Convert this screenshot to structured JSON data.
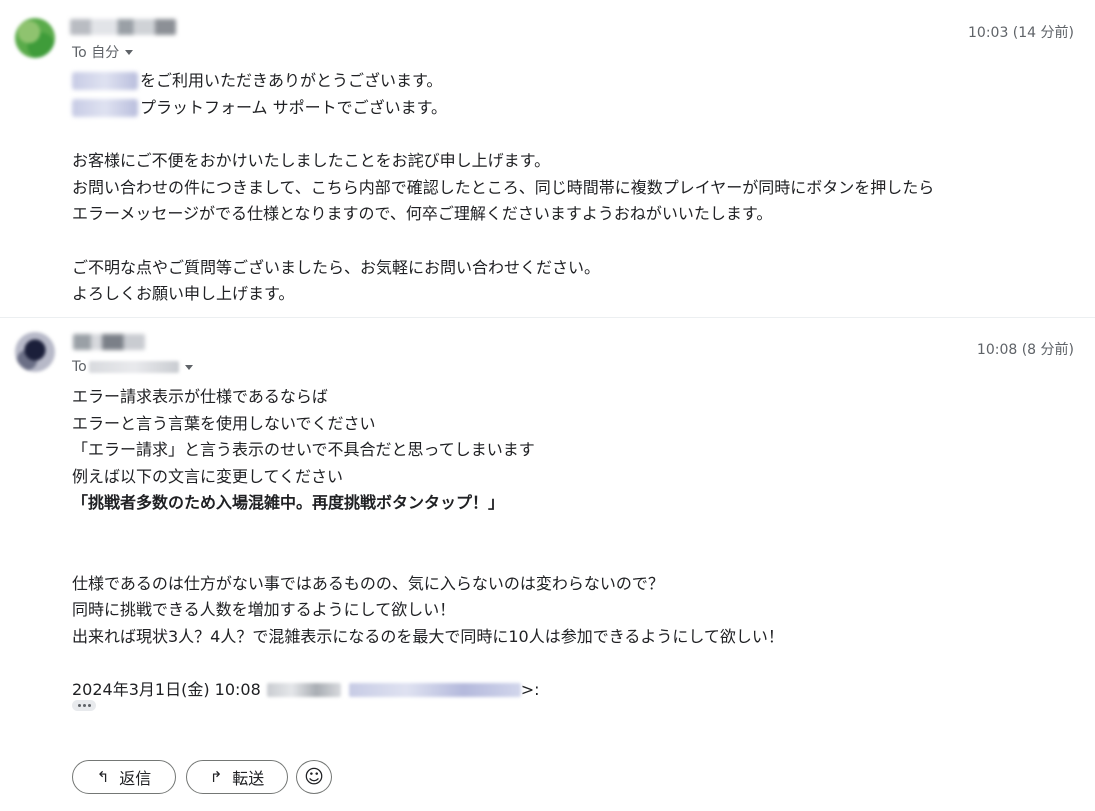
{
  "messages": [
    {
      "to_label": "To 自分",
      "timestamp": "10:03 (14 分前)",
      "lines": [
        "をご利用いただきありがとうございます。",
        "プラットフォーム サポートでございます。",
        "お客様にご不便をおかけいたしましたことをお詫び申し上げます。",
        "お問い合わせの件につきまして、こちら内部で確認したところ、同じ時間帯に複数プレイヤーが同時にボタンを押したら",
        "エラーメッセージがでる仕様となりますので、何卒ご理解くださいますようおねがいいたします。",
        "ご不明な点やご質問等ございましたら、お気軽にお問い合わせください。",
        "よろしくお願い申し上げます。"
      ]
    },
    {
      "to_label": "To",
      "timestamp": "10:08 (8 分前)",
      "lines": [
        "エラー請求表示が仕様であるならば",
        "エラーと言う言葉を使用しないでください",
        "「エラー請求」と言う表示のせいで不具合だと思ってしまいます",
        "例えば以下の文言に変更してください",
        "「挑戦者多数のため入場混雑中。再度挑戦ボタンタップ！」",
        "仕様であるのは仕方がない事ではあるものの、気に入らないのは変わらないので？",
        "同時に挑戦できる人数を増加するようにして欲しい！",
        "出来れば現状3人？4人？で混雑表示になるのを最大で同時に10人は参加できるようにして欲しい！"
      ],
      "quote_prefix": "2024年3月1日(金) 10:08",
      "quote_suffix": ">:"
    }
  ],
  "actions": {
    "reply_label": "返信",
    "forward_label": "転送"
  }
}
